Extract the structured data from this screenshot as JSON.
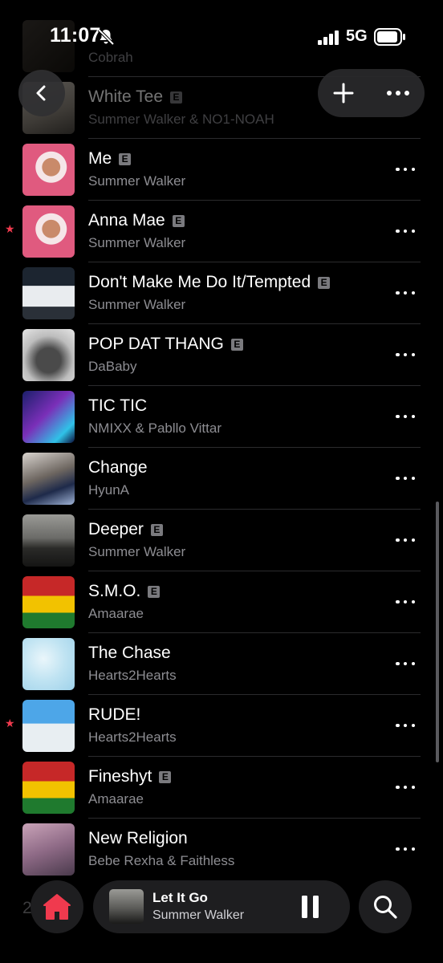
{
  "status": {
    "time": "11:07",
    "network": "5G"
  },
  "header": {
    "back_label": "Back",
    "add_label": "Add",
    "more_label": "More"
  },
  "songs": [
    {
      "title": "",
      "artist": "Cobrah",
      "explicit": false,
      "favorite": false
    },
    {
      "title": "White Tee",
      "artist": "Summer Walker & NO1-NOAH",
      "explicit": true,
      "favorite": false
    },
    {
      "title": "Me",
      "artist": "Summer Walker",
      "explicit": true,
      "favorite": false
    },
    {
      "title": "Anna Mae",
      "artist": "Summer Walker",
      "explicit": true,
      "favorite": true
    },
    {
      "title": "Don't Make Me Do It/Tempted",
      "artist": "Summer Walker",
      "explicit": true,
      "favorite": false
    },
    {
      "title": "POP DAT THANG",
      "artist": "DaBaby",
      "explicit": true,
      "favorite": false
    },
    {
      "title": "TIC TIC",
      "artist": "NMIXX & Pabllo Vittar",
      "explicit": false,
      "favorite": false
    },
    {
      "title": "Change",
      "artist": "HyunA",
      "explicit": false,
      "favorite": false
    },
    {
      "title": "Deeper",
      "artist": "Summer Walker",
      "explicit": true,
      "favorite": false
    },
    {
      "title": "S.M.O.",
      "artist": "Amaarae",
      "explicit": true,
      "favorite": false
    },
    {
      "title": "The Chase",
      "artist": "Hearts2Hearts",
      "explicit": false,
      "favorite": false
    },
    {
      "title": "RUDE!",
      "artist": "Hearts2Hearts",
      "explicit": false,
      "favorite": true
    },
    {
      "title": "Fineshyt",
      "artist": "Amaarae",
      "explicit": true,
      "favorite": false
    },
    {
      "title": "New Religion",
      "artist": "Bebe Rexha & Faithless",
      "explicit": false,
      "favorite": false
    }
  ],
  "explicit_badge": "E",
  "favorite_mark": "★",
  "footer": {
    "partial_text": "2"
  },
  "now_playing": {
    "title": "Let It Go",
    "artist": "Summer Walker"
  },
  "colors": {
    "accent": "#f03a4e",
    "background": "#000000",
    "secondary_text": "#8d8d92"
  }
}
